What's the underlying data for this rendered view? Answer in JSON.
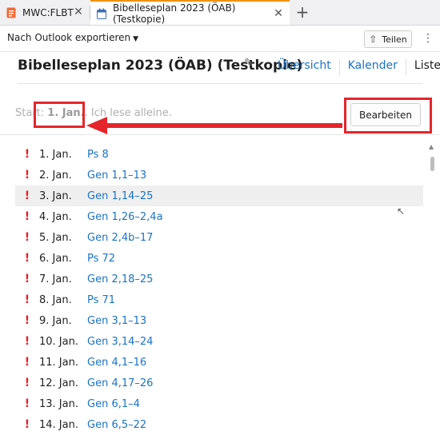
{
  "tabs": [
    {
      "label": "MWC:FLBT",
      "icon": "document-icon"
    },
    {
      "label": "Bibelleseplan 2023 (ÖAB) (Testkopie)",
      "icon": "calendar-icon"
    }
  ],
  "toolbar": {
    "export_label": "Nach Outlook exportieren",
    "share_label": "Teilen"
  },
  "header": {
    "title": "Bibelleseplan 2023 (ÖAB) (Testkopie)",
    "views": [
      "Übersicht",
      "Kalender",
      "Liste"
    ],
    "active_view": "Liste"
  },
  "start": {
    "prefix": "Start: ",
    "date": "1. Jan.",
    "suffix": ". Ich lese alleine.",
    "edit_label": "Bearbeiten"
  },
  "colors": {
    "accent": "#f29200",
    "link": "#1a73c6",
    "highlight": "#e4262c"
  },
  "entries": [
    {
      "day": "1. Jan.",
      "ref": "Ps 8"
    },
    {
      "day": "2. Jan.",
      "ref": "Gen 1,1–13"
    },
    {
      "day": "3. Jan.",
      "ref": "Gen 1,14–25"
    },
    {
      "day": "4. Jan.",
      "ref": "Gen 1,26–2,4a"
    },
    {
      "day": "5. Jan.",
      "ref": "Gen 2,4b–17"
    },
    {
      "day": "6. Jan.",
      "ref": "Ps 72"
    },
    {
      "day": "7. Jan.",
      "ref": "Gen 2,18–25"
    },
    {
      "day": "8. Jan.",
      "ref": "Ps 71"
    },
    {
      "day": "9. Jan.",
      "ref": "Gen 3,1–13"
    },
    {
      "day": "10. Jan.",
      "ref": "Gen 3,14–24"
    },
    {
      "day": "11. Jan.",
      "ref": "Gen 4,1–16"
    },
    {
      "day": "12. Jan.",
      "ref": "Gen 4,17–26"
    },
    {
      "day": "13. Jan.",
      "ref": "Gen 6,1–4"
    },
    {
      "day": "14. Jan.",
      "ref": "Gen 6,5–22"
    }
  ]
}
